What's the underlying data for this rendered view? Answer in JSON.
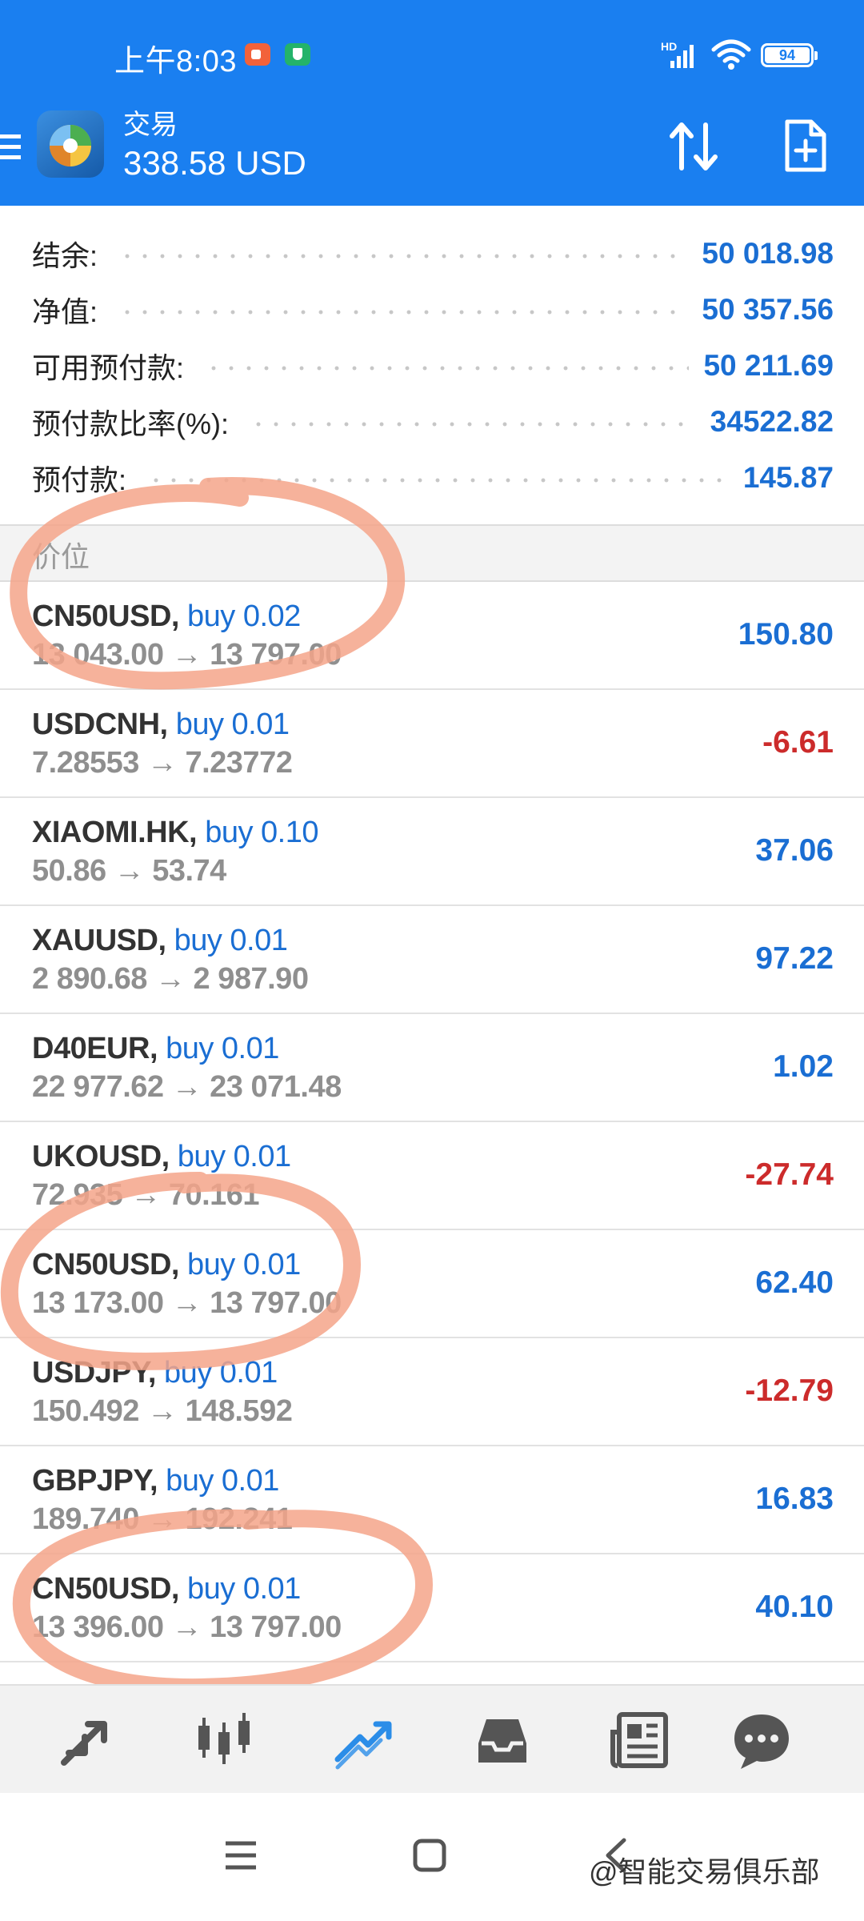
{
  "status_bar": {
    "time": "上午8:03",
    "network": "HD",
    "battery": "94"
  },
  "header": {
    "title": "交易",
    "balance": "338.58 USD",
    "icons": [
      "menu-icon",
      "app-logo",
      "sort-icon",
      "new-order-icon"
    ]
  },
  "summary": [
    {
      "label": "结余:",
      "value": "50 018.98"
    },
    {
      "label": "净值:",
      "value": "50 357.56"
    },
    {
      "label": "可用预付款:",
      "value": "50 211.69"
    },
    {
      "label": "预付款比率(%):",
      "value": "34522.82"
    },
    {
      "label": "预付款:",
      "value": "145.87"
    }
  ],
  "section_title": "价位",
  "positions": [
    {
      "symbol": "CN50USD,",
      "side": "buy 0.02",
      "prices": "13 043.00 → 13 797.00",
      "profit": "150.80"
    },
    {
      "symbol": "USDCNH,",
      "side": "buy 0.01",
      "prices": "7.28553 → 7.23772",
      "profit": "-6.61"
    },
    {
      "symbol": "XIAOMI.HK,",
      "side": "buy 0.10",
      "prices": "50.86 → 53.74",
      "profit": "37.06"
    },
    {
      "symbol": "XAUUSD,",
      "side": "buy 0.01",
      "prices": "2 890.68 → 2 987.90",
      "profit": "97.22"
    },
    {
      "symbol": "D40EUR,",
      "side": "buy 0.01",
      "prices": "22 977.62 → 23 071.48",
      "profit": "1.02"
    },
    {
      "symbol": "UKOUSD,",
      "side": "buy 0.01",
      "prices": "72.935 → 70.161",
      "profit": "-27.74"
    },
    {
      "symbol": "CN50USD,",
      "side": "buy 0.01",
      "prices": "13 173.00 → 13 797.00",
      "profit": "62.40"
    },
    {
      "symbol": "USDJPY,",
      "side": "buy 0.01",
      "prices": "150.492 → 148.592",
      "profit": "-12.79"
    },
    {
      "symbol": "GBPJPY,",
      "side": "buy 0.01",
      "prices": "189.740 → 192.241",
      "profit": "16.83"
    },
    {
      "symbol": "CN50USD,",
      "side": "buy 0.01",
      "prices": "13 396.00 → 13 797.00",
      "profit": "40.10"
    }
  ],
  "bottom_nav": [
    {
      "icon": "quotes-icon",
      "active": false
    },
    {
      "icon": "chart-candles-icon",
      "active": false
    },
    {
      "icon": "trade-icon",
      "active": true
    },
    {
      "icon": "history-inbox-icon",
      "active": false
    },
    {
      "icon": "news-icon",
      "active": false
    },
    {
      "icon": "chat-icon",
      "active": false
    }
  ],
  "watermark": "@智能交易俱乐部",
  "colors": {
    "header_bg": "#1a7ff0",
    "value_blue": "#1a6ed3",
    "loss_red": "#cc2b2b",
    "annotation": "#f4a58a"
  }
}
